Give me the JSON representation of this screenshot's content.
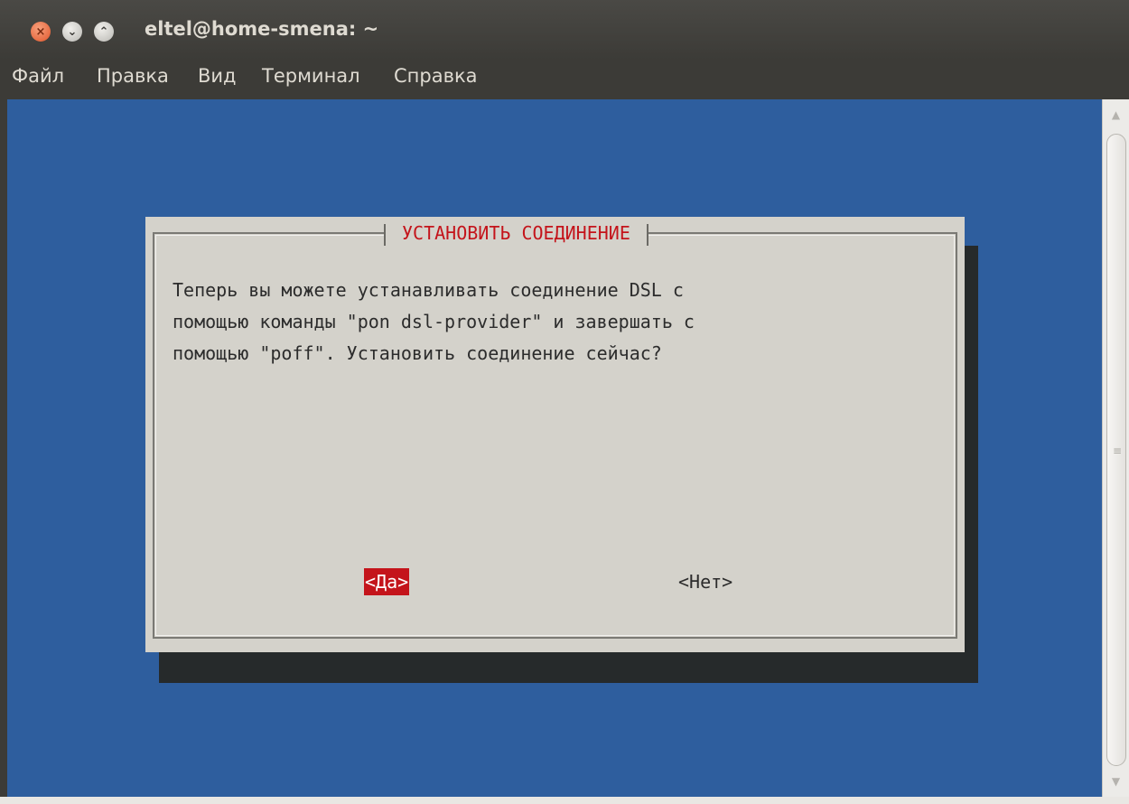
{
  "window": {
    "title": "eltel@home-smena: ~",
    "close_glyph": "×",
    "minimize_glyph": "⌄",
    "maximize_glyph": "⌃"
  },
  "menu": {
    "items": [
      "Файл",
      "Правка",
      "Вид",
      "Терминал",
      "Справка"
    ]
  },
  "dialog": {
    "title": "УСТАНОВИТЬ СОЕДИНЕНИЕ",
    "message_lines": [
      "Теперь вы можете устанавливать соединение DSL с",
      "помощью команды \"pon dsl-provider\" и завершать с",
      "помощью \"poff\". Установить соединение сейчас?"
    ],
    "yes_label": "<Да>",
    "no_label": "<Нет>"
  },
  "scrollbar": {
    "up_arrow": "▲",
    "down_arrow": "▼",
    "grip": "≡"
  },
  "colors": {
    "terminal_bg": "#2e5e9e",
    "dialog_bg": "#d4d2cb",
    "accent_red": "#c4141b",
    "titlebar_bg": "#3c3b37"
  }
}
